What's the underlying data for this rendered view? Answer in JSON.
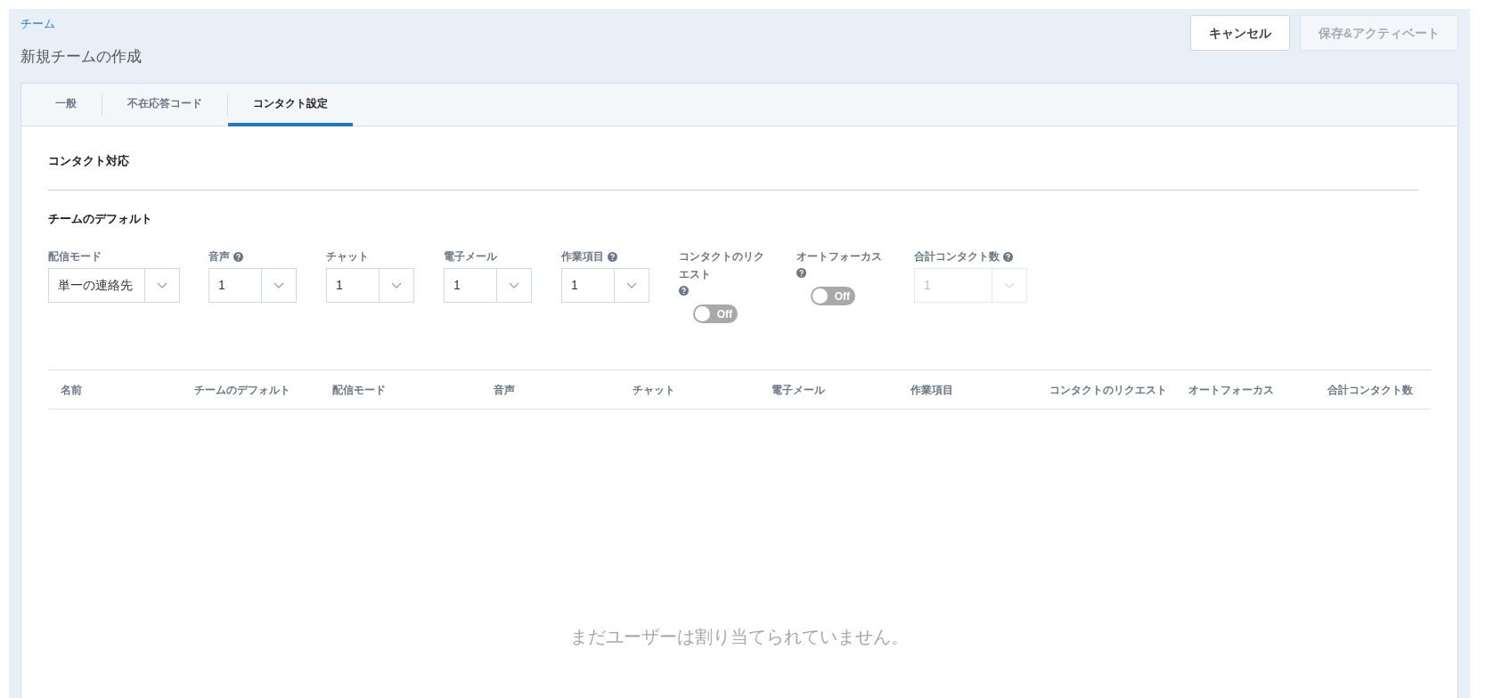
{
  "breadcrumb": "チーム",
  "page_title": "新規チームの作成",
  "header_buttons": [
    {
      "label": "キャンセル",
      "disabled": false
    },
    {
      "label": "保存&アクティベート",
      "disabled": true
    }
  ],
  "tabs": [
    {
      "label": "一般",
      "selected": false
    },
    {
      "label": "不在応答コード",
      "selected": false
    },
    {
      "label": "コンタクト設定",
      "selected": true
    }
  ],
  "section_title": "コンタクト対応",
  "subsection_title": "チームのデフォルト",
  "fields": [
    {
      "kind": "select",
      "label": "配信モード",
      "help": false,
      "value": "単一の連絡先",
      "disabled": false
    },
    {
      "kind": "select",
      "label": "音声",
      "help": true,
      "value": "1",
      "disabled": false
    },
    {
      "kind": "select",
      "label": "チャット",
      "help": false,
      "value": "1",
      "disabled": false
    },
    {
      "kind": "select",
      "label": "電子メール",
      "help": false,
      "value": "1",
      "disabled": false
    },
    {
      "kind": "select",
      "label": "作業項目",
      "help": true,
      "value": "1",
      "disabled": false
    },
    {
      "kind": "toggle",
      "label": "コンタクトのリクエスト",
      "help": true,
      "on": false,
      "state_label": "Off"
    },
    {
      "kind": "toggle",
      "label": "オートフォーカス",
      "help": true,
      "on": false,
      "state_label": "Off"
    },
    {
      "kind": "select",
      "label": "合計コンタクト数",
      "help": true,
      "value": "1",
      "disabled": true
    }
  ],
  "table": {
    "columns": [
      "名前",
      "チームのデフォルト",
      "配信モード",
      "音声",
      "チャット",
      "電子メール",
      "作業項目",
      "コンタクトのリクエスト",
      "オートフォーカス",
      "合計コンタクト数"
    ],
    "empty_message": "まだユーザーは割り当てられていません。"
  }
}
